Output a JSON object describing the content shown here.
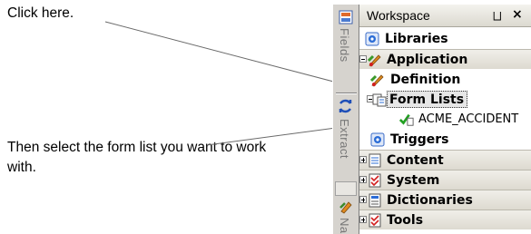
{
  "callouts": {
    "first": "Click here.",
    "second": "Then select the form list you want to work with."
  },
  "side_tabs": {
    "fields": "Fields",
    "extract": "Extract",
    "next": "Na"
  },
  "workspace": {
    "title": "Workspace",
    "pin_glyph": "⨆",
    "close_glyph": "×",
    "rows": {
      "libraries": "Libraries",
      "application": "Application",
      "definition": "Definition",
      "form_lists": "Form Lists",
      "form_list_item": "ACME_ACCIDENT",
      "triggers": "Triggers",
      "content": "Content",
      "system": "System",
      "dictionaries": "Dictionaries",
      "tools": "Tools"
    }
  },
  "colors": {
    "accent_blue": "#2b6cd6",
    "check_green": "#22a022",
    "pencil_orange": "#e08a1e",
    "red_mark": "#d22020"
  }
}
